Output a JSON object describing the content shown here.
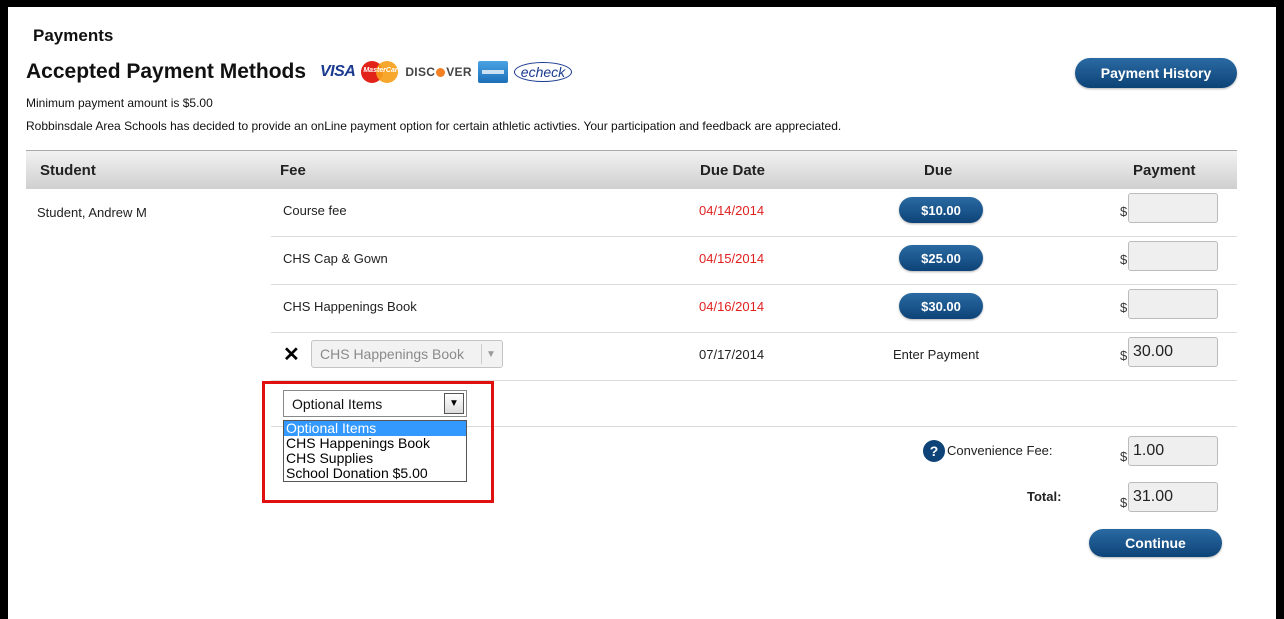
{
  "header": {
    "title": "Payments",
    "methods_title": "Accepted Payment Methods",
    "payment_history_label": "Payment History",
    "minimum_text": "Minimum payment amount is $5.00",
    "info_text": "Robbinsdale Area Schools has decided to provide an onLine payment option for certain athletic activties.  Your participation and feedback are appreciated."
  },
  "logos": {
    "visa": "VISA",
    "mastercard": "MasterCard",
    "discover_pre": "DISC",
    "discover_post": "VER",
    "echeck": "echeck",
    "icons": [
      "visa-logo",
      "mastercard-logo",
      "discover-logo",
      "amex-logo",
      "echeck-logo"
    ]
  },
  "table": {
    "columns": [
      "Student",
      "Fee",
      "Due Date",
      "Due",
      "Payment"
    ],
    "student": "Student, Andrew M",
    "rows": [
      {
        "fee": "Course fee",
        "due_date": "04/14/2014",
        "due": "$10.00",
        "payment": ""
      },
      {
        "fee": "CHS Cap & Gown",
        "due_date": "04/15/2014",
        "due": "$25.00",
        "payment": ""
      },
      {
        "fee": "CHS Happenings Book",
        "due_date": "04/16/2014",
        "due": "$30.00",
        "payment": ""
      }
    ],
    "added_item": {
      "select_value": "CHS Happenings Book",
      "due_date": "07/17/2014",
      "due_text": "Enter Payment",
      "payment": "30.00"
    },
    "currency_symbol": "$"
  },
  "optional": {
    "selected": "Optional Items",
    "options": [
      "Optional Items",
      "CHS Happenings Book",
      "CHS Supplies",
      "School Donation $5.00"
    ]
  },
  "summary": {
    "convenience_label": "Convenience Fee:",
    "convenience_value": "1.00",
    "total_label": "Total:",
    "total_value": "31.00",
    "help_glyph": "?",
    "continue_label": "Continue"
  },
  "colors": {
    "accent": "#0d4377",
    "overdue": "#e02020",
    "highlight": "#e01010",
    "selected_option": "#3399ff"
  }
}
